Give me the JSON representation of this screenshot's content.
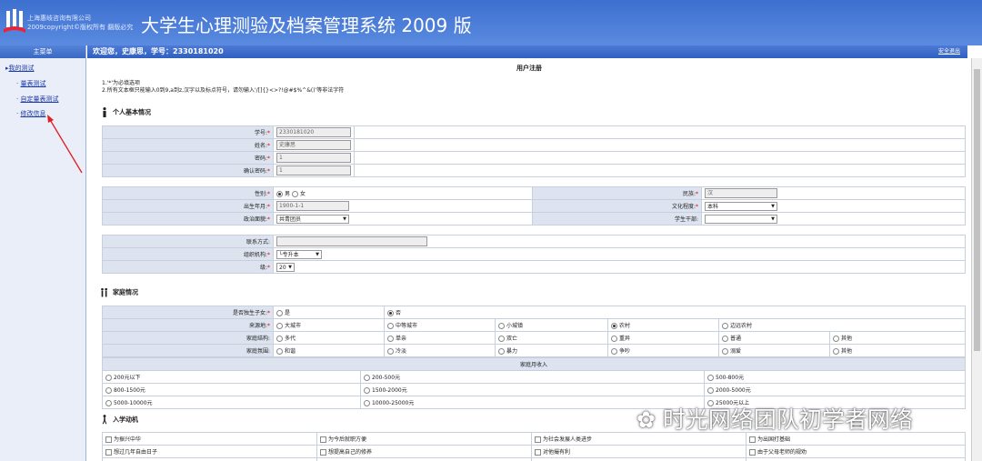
{
  "header": {
    "company_line1": "上海惠岐咨询有限公司",
    "company_line2": "2009copyright©版权所有 翻版必究",
    "title": "大学生心理测验及档案管理系统 2009 版"
  },
  "sidebar": {
    "title": "主菜单",
    "items": [
      {
        "label": "我的测试"
      },
      {
        "label": "量表测试"
      },
      {
        "label": "自定量表测试"
      },
      {
        "label": "修改信息"
      }
    ]
  },
  "welcome": {
    "text": "欢迎您，史康思，学号：2330181020",
    "logout": "安全退出"
  },
  "page": {
    "title": "用户注册",
    "note1": "1.'*'为必填选项",
    "note2": "2.所有文本框只能输入0到9,a到z,汉字以及标点符号，请勿输入'/[]{}<>?!@#$%^&()'等非法字符"
  },
  "sections": {
    "basic": "个人基本情况",
    "family": "家庭情况",
    "income": "家庭月收入",
    "motive": "入学动机"
  },
  "basic": {
    "student_id_label": "学号:",
    "student_id": "2330181020",
    "name_label": "姓名:",
    "name": "史康思",
    "password_label": "密码:",
    "password": "1",
    "confirm_label": "确认密码:",
    "confirm": "1"
  },
  "info": {
    "gender_label": "性别:",
    "male": "男",
    "female": "女",
    "ethnic_label": "民族:",
    "ethnic": "汉",
    "birth_label": "出生年月:",
    "birth": "1900-1-1",
    "edu_label": "文化程度:",
    "edu": "本科",
    "political_label": "政治面貌:",
    "political": "共青团员",
    "cadre_label": "学生干部:",
    "cadre": ""
  },
  "contact": {
    "contact_label": "联系方式:",
    "contact": "",
    "org_label": "组织机构:",
    "org": "└专升本",
    "grade_label": "级:",
    "grade": "20"
  },
  "family": {
    "only_child_label": "是否独生子女:",
    "yes": "是",
    "no": "否",
    "origin_label": "来源地:",
    "origins": [
      "大城市",
      "中等城市",
      "小城镇",
      "农村",
      "边远农村"
    ],
    "structure_label": "家庭结构:",
    "structures": [
      "多代",
      "单亲",
      "双亡",
      "重异",
      "普通",
      "其他"
    ],
    "atmosphere_label": "家庭氛围:",
    "atmospheres": [
      "和谐",
      "冷淡",
      "暴力",
      "争吵",
      "溺爱",
      "其他"
    ]
  },
  "income": [
    "200元以下",
    "200-500元",
    "500-800元",
    "800-1500元",
    "1500-2000元",
    "2000-5000元",
    "5000-10000元",
    "10000-25000元",
    "25000元以上"
  ],
  "motive": [
    "为振兴中华",
    "为今后就职方便",
    "为社会发展人类进步",
    "为出国打基础",
    "想过几年自由日子",
    "想提高自己的修养",
    "对他撮有利",
    "由于父母老师的规劝"
  ],
  "watermark": "时光网络团队初学者网络"
}
